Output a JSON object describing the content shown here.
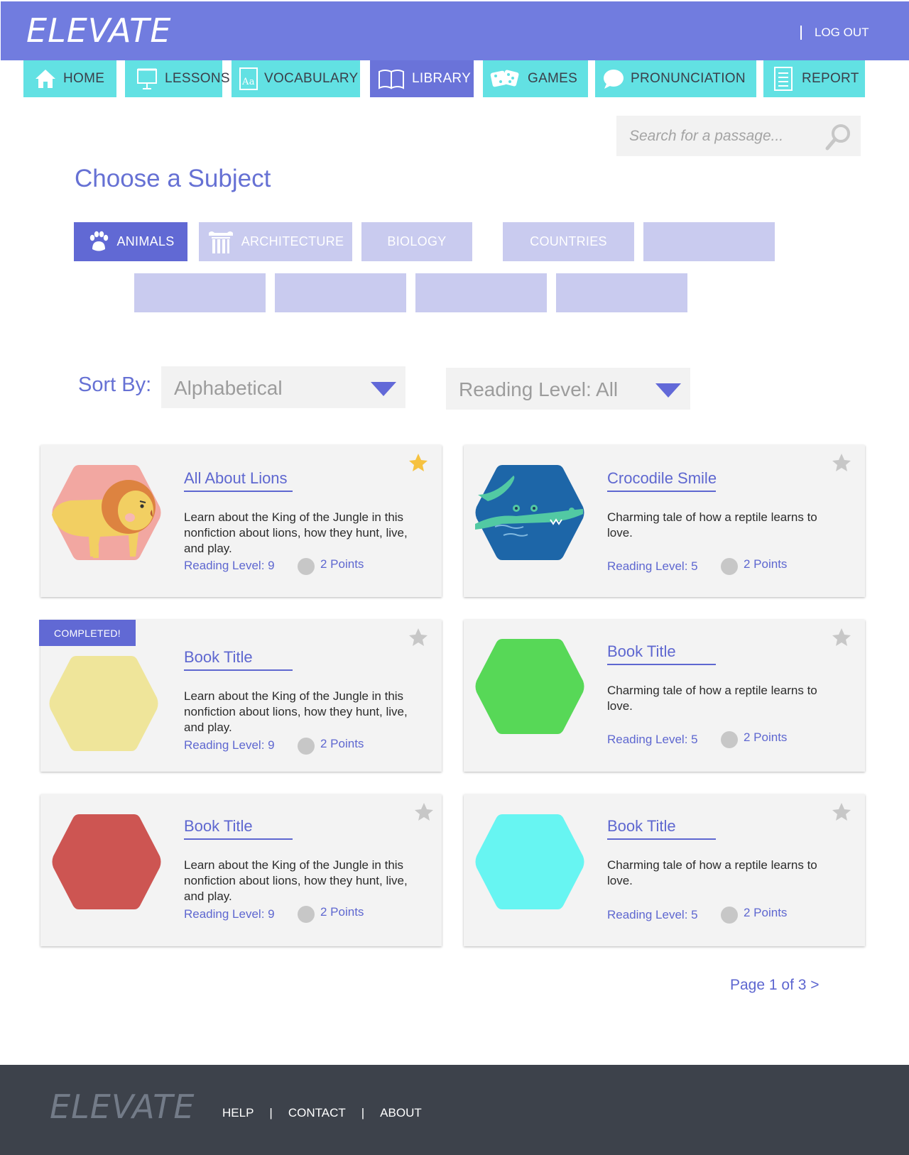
{
  "header": {
    "logo": "ELEVATE",
    "logout": "LOG OUT"
  },
  "nav": [
    {
      "label": "HOME",
      "icon": "home-icon"
    },
    {
      "label": "LESSONS",
      "icon": "presentation-board-icon"
    },
    {
      "label": "VOCABULARY",
      "icon": "dictionary-icon"
    },
    {
      "label": "LIBRARY",
      "icon": "open-book-icon",
      "active": true
    },
    {
      "label": "GAMES",
      "icon": "dice-icon"
    },
    {
      "label": "PRONUNCIATION",
      "icon": "speech-bubble-icon"
    },
    {
      "label": "REPORT",
      "icon": "document-icon"
    }
  ],
  "search": {
    "placeholder": "Search for a passage..."
  },
  "subjects": {
    "title": "Choose a Subject",
    "items": [
      {
        "label": "ANIMALS",
        "icon": "paw-icon",
        "active": true
      },
      {
        "label": "ARCHITECTURE",
        "icon": "column-icon"
      },
      {
        "label": "BIOLOGY"
      },
      {
        "label": "COUNTRIES"
      },
      {
        "label": ""
      },
      {
        "label": ""
      },
      {
        "label": ""
      },
      {
        "label": ""
      },
      {
        "label": ""
      }
    ]
  },
  "sort": {
    "label": "Sort By:",
    "value": "Alphabetical",
    "level_value": "Reading Level: All"
  },
  "books": [
    {
      "title": "All About Lions",
      "description": "Learn about the King of the Jungle in this nonfiction about lions, how they hunt, live, and play.",
      "reading_level": "Reading Level: 9",
      "points": "2 Points",
      "favorite": true,
      "completed": false,
      "color": "#f2a7a1",
      "image": "lion"
    },
    {
      "title": "Crocodile Smile",
      "description": "Charming tale of how a reptile learns to love.",
      "reading_level": "Reading Level: 5",
      "points": "2 Points",
      "favorite": false,
      "completed": false,
      "color": "#1d66a8",
      "image": "crocodile"
    },
    {
      "title": "Book Title",
      "description": "Learn about the King of the Jungle in this nonfiction about lions, how they hunt, live, and play.",
      "reading_level": "Reading Level: 9",
      "points": "2 Points",
      "favorite": false,
      "completed": true,
      "completed_label": "COMPLETED!",
      "color": "#efe59a"
    },
    {
      "title": "Book Title",
      "description": "Charming tale of how a reptile learns to love.",
      "reading_level": "Reading Level: 5",
      "points": "2 Points",
      "favorite": false,
      "completed": false,
      "color": "#57d857"
    },
    {
      "title": "Book Title",
      "description": "Learn about the King of the Jungle in this nonfiction about lions, how they hunt, live, and play.",
      "reading_level": "Reading Level: 9",
      "points": "2 Points",
      "favorite": false,
      "completed": false,
      "color": "#cd5552"
    },
    {
      "title": "Book Title",
      "description": "Charming tale of how a reptile learns to love.",
      "reading_level": "Reading Level: 5",
      "points": "2 Points",
      "favorite": false,
      "completed": false,
      "color": "#67f5f2"
    }
  ],
  "pagination": {
    "label": "Page 1 of 3 >"
  },
  "footer": {
    "logo": "ELEVATE",
    "links": [
      "HELP",
      "CONTACT",
      "ABOUT"
    ],
    "separator": "|"
  },
  "colors": {
    "header": "#717cdf",
    "nav": "#62e1e3",
    "nav_active": "#6a73d9",
    "accent": "#5e67d0",
    "subject_inactive": "#c9cbef",
    "footer": "#3d424b",
    "star_active": "#f6c240",
    "star_inactive": "#c7c7c7"
  }
}
